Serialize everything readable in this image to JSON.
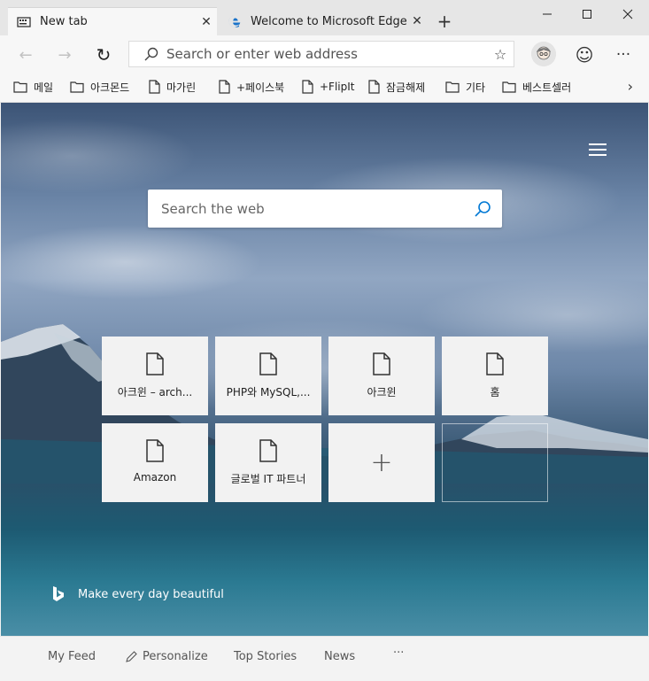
{
  "tabs": [
    {
      "title": "New tab",
      "close": "✕"
    },
    {
      "title": "Welcome to Microsoft Edge Dev",
      "close": "✕"
    }
  ],
  "new_tab_label": "+",
  "window_controls": {
    "minimize": "—",
    "maximize": "☐",
    "close": "✕"
  },
  "navbar": {
    "back": "←",
    "forward": "→",
    "refresh": "↻",
    "address_placeholder": "Search or enter web address",
    "favorite": "☆",
    "emoji": "☺",
    "menu": "···"
  },
  "favorites": [
    {
      "label": "메일",
      "icon": "folder-icon"
    },
    {
      "label": "아크몬드",
      "icon": "folder-icon"
    },
    {
      "label": "마가린",
      "icon": "page-icon"
    },
    {
      "label": "+페이스북",
      "icon": "page-icon"
    },
    {
      "label": "+FlipIt",
      "icon": "page-icon"
    },
    {
      "label": "잠금해제",
      "icon": "page-icon"
    },
    {
      "label": "기타",
      "icon": "folder-icon"
    },
    {
      "label": "베스트셀러",
      "icon": "folder-icon"
    }
  ],
  "favorites_more": "›",
  "newtab_page": {
    "search_placeholder": "Search the web",
    "tiles": [
      "아크윈 – arch...",
      "PHP와 MySQL,...",
      "아크윈",
      "홈",
      "Amazon",
      "글로벌 IT 파트너"
    ],
    "add_tile": "+",
    "bing_caption": "Make every day beautiful"
  },
  "feedbar": {
    "my_feed": "My Feed",
    "personalize": "Personalize",
    "top_stories": "Top Stories",
    "news": "News",
    "more": "···"
  },
  "colors": {
    "accent": "#0078d4",
    "tab_active": "#f7f7f7",
    "tab_bar": "#e6e6e6"
  }
}
